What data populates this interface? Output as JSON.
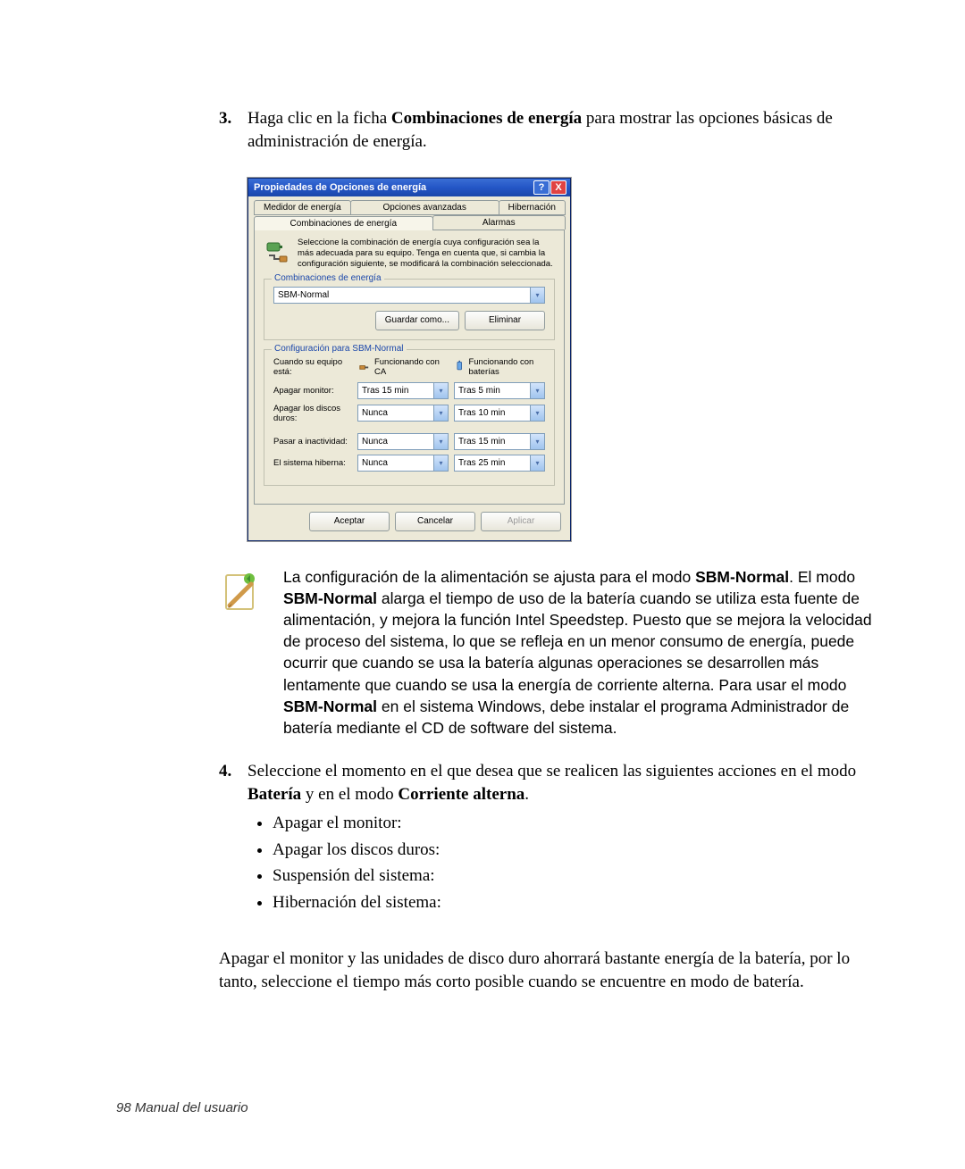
{
  "step3": {
    "num": "3.",
    "pre": "Haga clic en la ficha ",
    "bold": "Combinaciones de energía",
    "post": " para mostrar las opciones básicas de administración de energía."
  },
  "dialog": {
    "title": "Propiedades de Opciones de energía",
    "help": "?",
    "close": "X",
    "tabs_row1": [
      "Medidor de energía",
      "Opciones avanzadas",
      "Hibernación"
    ],
    "tabs_row2": [
      "Combinaciones de energía",
      "Alarmas"
    ],
    "active_tab_index_row2": 0,
    "intro": "Seleccione la combinación de energía  cuya configuración sea la más adecuada para su equipo. Tenga en cuenta que, si cambia la configuración siguiente, se modificará la combinación seleccionada.",
    "group1": {
      "legend": "Combinaciones de energía",
      "combo_value": "SBM-Normal",
      "save_as": "Guardar como...",
      "delete": "Eliminar"
    },
    "group2": {
      "legend": "Configuración para SBM-Normal",
      "when_label": "Cuando su equipo está:",
      "ac_label": "Funcionando con CA",
      "dc_label": "Funcionando con baterías",
      "rows": [
        {
          "label": "Apagar monitor:",
          "ac": "Tras 15 min",
          "dc": "Tras 5 min"
        },
        {
          "label": "Apagar los discos duros:",
          "ac": "Nunca",
          "dc": "Tras 10 min"
        },
        {
          "label": "Pasar a inactividad:",
          "ac": "Nunca",
          "dc": "Tras 15 min"
        },
        {
          "label": "El sistema hiberna:",
          "ac": "Nunca",
          "dc": "Tras 25 min"
        }
      ]
    },
    "footer": {
      "ok": "Aceptar",
      "cancel": "Cancelar",
      "apply": "Aplicar"
    }
  },
  "note": {
    "p1a": "La configuración de la alimentación se ajusta para el modo ",
    "b1": "SBM-Normal",
    "p1b": ". El modo ",
    "b2": "SBM-Normal",
    "p1c": " alarga el tiempo de uso de la batería cuando se utiliza esta fuente de alimentación, y mejora la función Intel Speedstep. Puesto que se mejora la velocidad de proceso del sistema, lo que se refleja en un menor consumo de energía, puede ocurrir que cuando se usa la batería algunas operaciones se desarrollen más lentamente que cuando se usa la energía de corriente alterna.  Para usar el modo ",
    "b3": "SBM-Normal",
    "p1d": " en el sistema Windows, debe instalar el programa Administrador de batería mediante el CD de software del sistema."
  },
  "step4": {
    "num": "4.",
    "a": "Seleccione el momento en el que desea que se realicen las siguientes acciones en el modo ",
    "b1": "Batería",
    "mid": " y en el modo ",
    "b2": "Corriente alterna",
    "end": "."
  },
  "bullets": [
    "Apagar el monitor:",
    "Apagar los discos duros:",
    "Suspensión del sistema:",
    "Hibernación del sistema:"
  ],
  "closing": "Apagar el monitor y las unidades de disco duro ahorrará bastante energía de la batería, por lo tanto, seleccione el tiempo más corto posible cuando se encuentre en modo de batería.",
  "footer": {
    "page": "98",
    "text": "  Manual del usuario"
  }
}
